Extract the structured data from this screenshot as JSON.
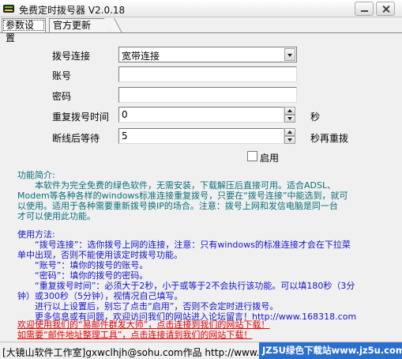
{
  "window": {
    "title": "免费定时拨号器 V2.0.18"
  },
  "tabs": [
    {
      "label": "参数设置"
    },
    {
      "label": "官方更新"
    }
  ],
  "form": {
    "connection_label": "拨号连接",
    "connection_value": "宽带连接",
    "account_label": "账号",
    "account_value": "",
    "password_label": "密码",
    "password_value": "",
    "redial_label": "重复拨号时间",
    "redial_value": "0",
    "redial_unit": "秒",
    "reconnect_label": "断线后等待",
    "reconnect_value": "5",
    "reconnect_unit": "秒再重拨",
    "enable_label": "启用",
    "enable_checked": false
  },
  "intro": {
    "heading": "功能简介:",
    "lines": [
      "　　本软件为完全免费的绿色软件，无需安装，下载解压后直接可用。适合ADSL、",
      "Modem等各种各样的windows标准连接重复拨号，只要在“拨号连接”中能选到，就可",
      "以使用。适用于各种需要重新拨号换IP的场合。注意：拨号上网和发信电脑是同一台",
      "才可以使用此功能。"
    ]
  },
  "usage": {
    "heading": "使用方法:",
    "lines": [
      "　　“拨号连接”：选你拨号上网的连接，注意：只有windows的标准连接才会在下拉菜",
      "单中出现，否则不能使用该定时拨号功能。",
      "　　“账号”：填你的拨号的账号。",
      "　　“密码”：填你的拨号的密码。",
      "　　“重复拨号时间”：必须大于2秒，小于或等于2不会执行该功能。可以填180秒（3分",
      "钟）或300秒（5分钟），视情况自己填写。",
      "　　进行以上设置后，别忘了点击“启用”，否则不会定时进行拨号。",
      "　　更多信息或有问题，欢迎访问我们的网站进入论坛留言！http://www.168318.com"
    ]
  },
  "promo": {
    "lines": [
      "欢迎使用我们的“易邮件群发大师”，点击连接到我们的网站下载！",
      "如需要“邮件地址整理工具”，点击连接请到我们的网站下载！"
    ]
  },
  "statusbar": {
    "text": "[大镜山软件工作室]gxwclhjh@sohu.com作品  http://www.168318.com",
    "watermark": "JZ5U绿色下载站www.jz5u.com"
  },
  "colors": {
    "intro_text": "#0a6f78",
    "usage_text": "#1515c8",
    "promo_text": "#e00000",
    "watermark_bg": "#2a6fcf"
  }
}
